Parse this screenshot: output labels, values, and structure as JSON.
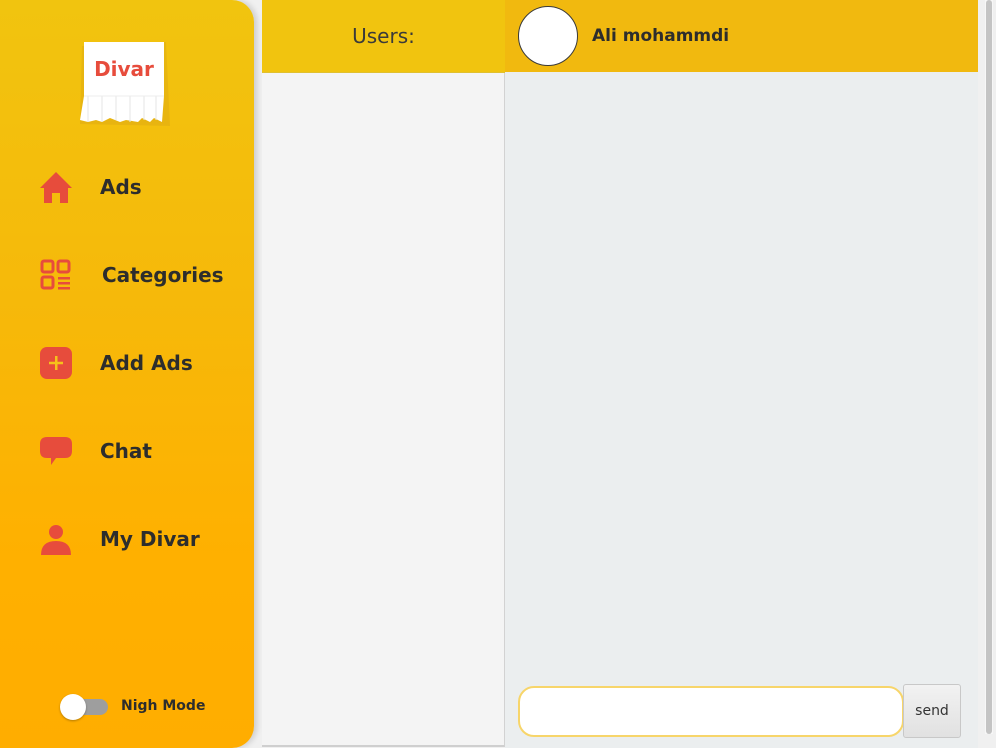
{
  "app": {
    "logo_text": "Divar",
    "brand_color": "#e74c3c",
    "accent_color": "#f1c40f"
  },
  "sidebar": {
    "items": [
      {
        "label": "Ads",
        "icon": "home-icon"
      },
      {
        "label": "Categories",
        "icon": "categories-icon"
      },
      {
        "label": "Add Ads",
        "icon": "add-icon"
      },
      {
        "label": "Chat",
        "icon": "chat-icon"
      },
      {
        "label": "My Divar",
        "icon": "user-icon"
      }
    ],
    "night_mode": {
      "label": "Nigh Mode",
      "enabled": false
    }
  },
  "users_panel": {
    "title": "Users:"
  },
  "chat": {
    "contact_name": "Ali mohammdi",
    "input_value": "",
    "send_label": "send"
  }
}
